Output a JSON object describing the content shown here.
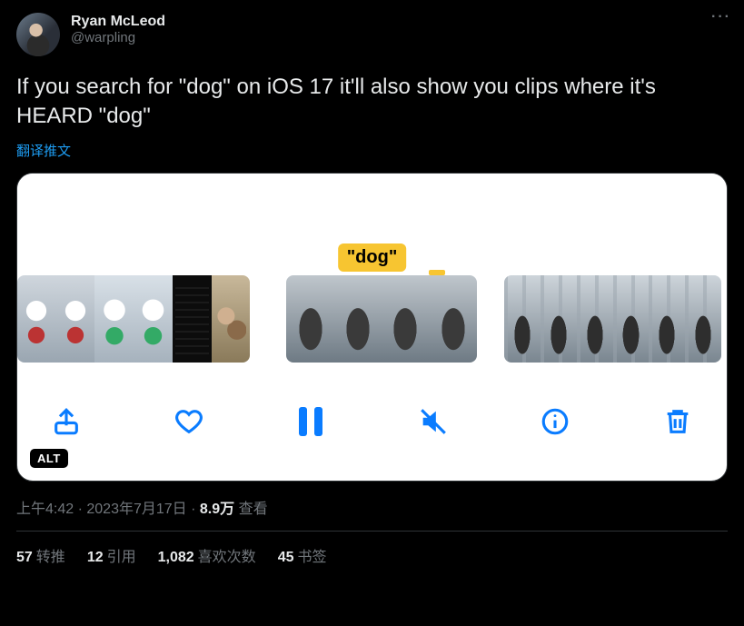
{
  "author": {
    "display_name": "Ryan McLeod",
    "handle": "@warpling"
  },
  "more_glyph": "···",
  "body": "If you search for \"dog\" on iOS 17 it'll also show you clips where it's HEARD \"dog\"",
  "translate_label": "翻译推文",
  "media": {
    "search_token": "\"dog\"",
    "alt_badge": "ALT",
    "toolbar": {
      "share": "share",
      "like": "like",
      "pause": "pause",
      "mute": "mute",
      "info": "info",
      "delete": "delete"
    }
  },
  "meta": {
    "time": "上午4:42",
    "sep1": " · ",
    "date": "2023年7月17日",
    "sep2": " · ",
    "views_num": "8.9万",
    "views_label": " 查看"
  },
  "stats": {
    "retweets_num": "57",
    "retweets_label": "转推",
    "quotes_num": "12",
    "quotes_label": "引用",
    "likes_num": "1,082",
    "likes_label": "喜欢次数",
    "bookmarks_num": "45",
    "bookmarks_label": "书签"
  }
}
